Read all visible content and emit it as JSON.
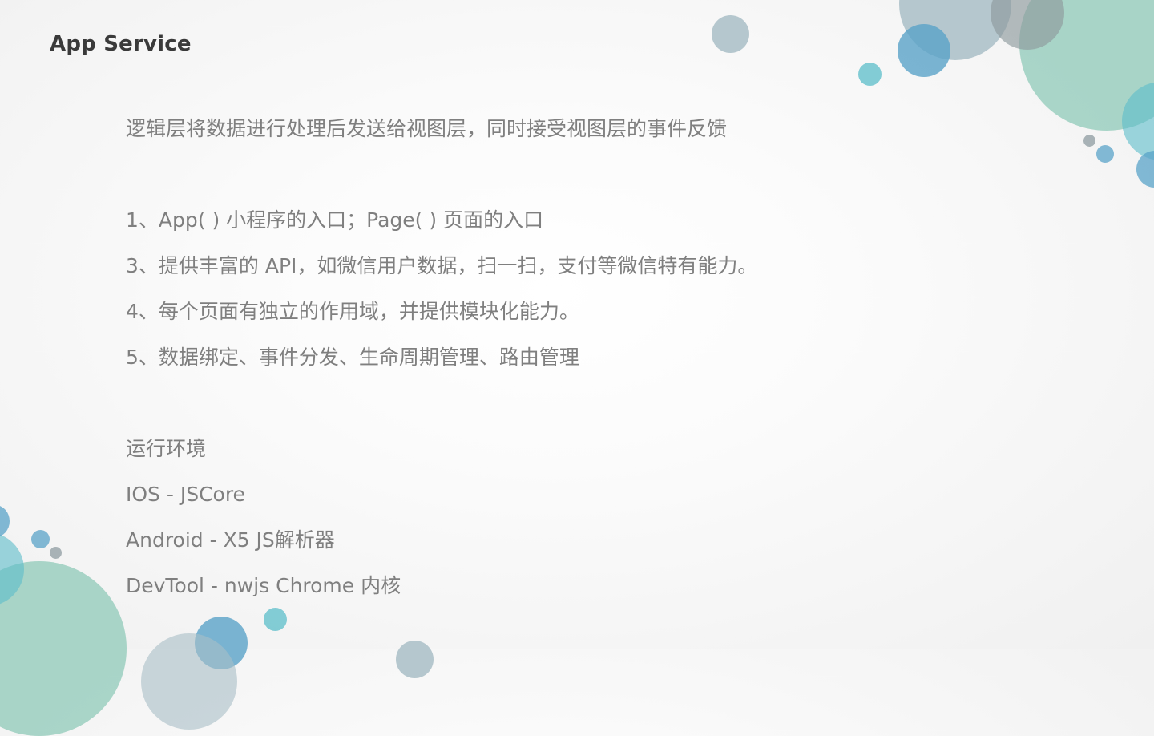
{
  "slide": {
    "title": "App Service",
    "intro": "逻辑层将数据进行处理后发送给视图层，同时接受视图层的事件反馈",
    "features": [
      "1、App( ) 小程序的入口；Page( ) 页面的入口",
      "3、提供丰富的 API，如微信用户数据，扫一扫，支付等微信特有能力。",
      "4、每个页面有独立的作用域，并提供模块化能力。",
      "5、数据绑定、事件分发、生命周期管理、路由管理"
    ],
    "runtime_heading": "运行环境",
    "runtimes": [
      "IOS - JSCore",
      "Android - X5 JS解析器",
      "DevTool - nwjs Chrome 内核"
    ]
  },
  "colors": {
    "title": "#3a3a3a",
    "body_text": "#7f7f7f",
    "bubble_green": "#8fcab8",
    "bubble_blue": "#5aa3c8",
    "bubble_teal": "#5bbdc9",
    "bubble_gray": "#9aa6aa",
    "bubble_slate": "#a9bec7"
  }
}
